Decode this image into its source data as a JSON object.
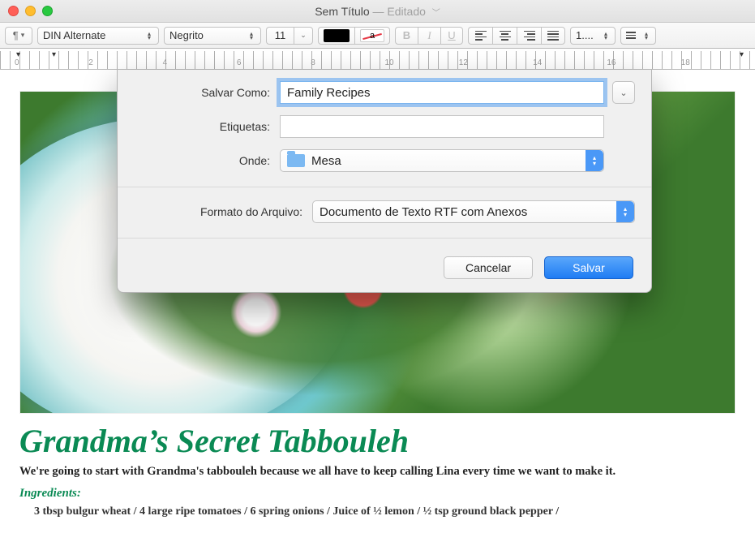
{
  "title": {
    "main": "Sem Título",
    "suffix": "Editado"
  },
  "toolbar": {
    "font_family": "DIN Alternate",
    "font_style": "Negrito",
    "font_size": "11",
    "spacing_value": "1....",
    "bold": "B",
    "italic": "I",
    "underline": "U"
  },
  "ruler": {
    "numbers": [
      "0",
      "2",
      "4",
      "6",
      "8",
      "10",
      "12",
      "14",
      "16",
      "18"
    ]
  },
  "doc": {
    "recipe_title": "Grandma’s Secret Tabbouleh",
    "intro": "We're going to start with Grandma's tabbouleh because we all have to keep calling Lina every time we want to make it.",
    "ingredients_label": "Ingredients:",
    "ingredients_line": "3 tbsp bulgur wheat / 4 large ripe tomatoes / 6 spring onions / Juice of ½ lemon / ½ tsp ground black pepper /"
  },
  "dialog": {
    "save_as_label": "Salvar Como:",
    "save_as_value": "Family Recipes",
    "tags_label": "Etiquetas:",
    "tags_value": "",
    "where_label": "Onde:",
    "where_value": "Mesa",
    "format_label": "Formato do Arquivo:",
    "format_value": "Documento de Texto RTF com Anexos",
    "cancel": "Cancelar",
    "save": "Salvar"
  }
}
